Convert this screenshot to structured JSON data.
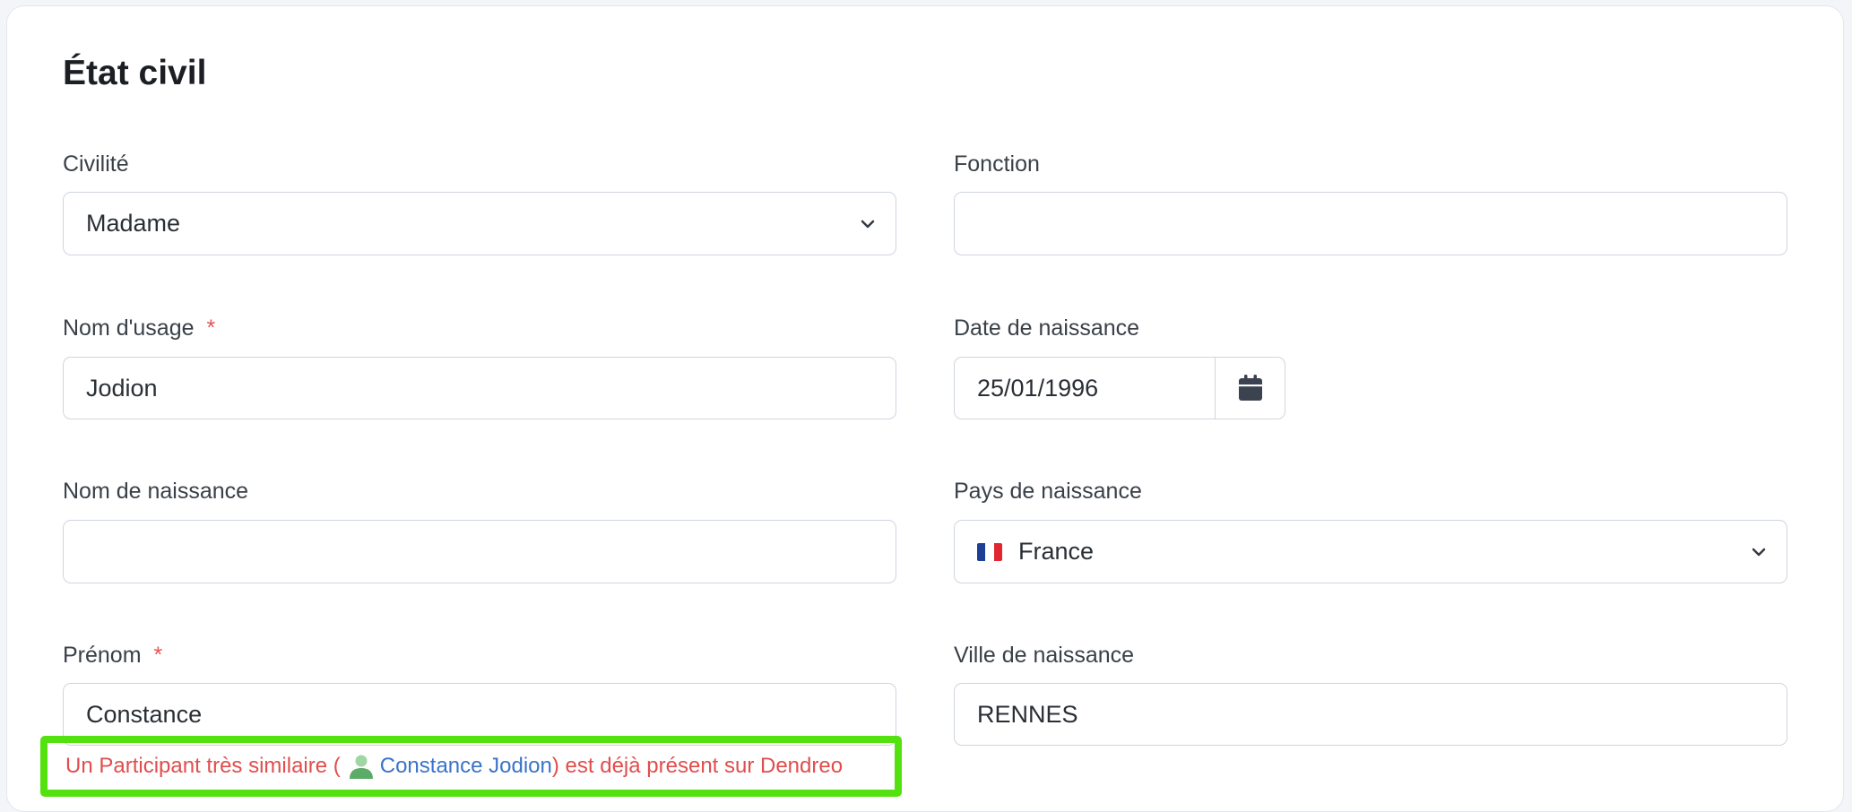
{
  "section": {
    "title": "État civil"
  },
  "fields": {
    "civilite": {
      "label": "Civilité",
      "value": "Madame"
    },
    "fonction": {
      "label": "Fonction",
      "value": ""
    },
    "nom_usage": {
      "label": "Nom d'usage",
      "required_mark": "*",
      "value": "Jodion"
    },
    "date_naissance": {
      "label": "Date de naissance",
      "value": "25/01/1996"
    },
    "nom_naissance": {
      "label": "Nom de naissance",
      "value": ""
    },
    "pays_naissance": {
      "label": "Pays de naissance",
      "value": "France"
    },
    "prenom": {
      "label": "Prénom",
      "required_mark": "*",
      "value": "Constance"
    },
    "ville_naissance": {
      "label": "Ville de naissance",
      "value": "RENNES"
    }
  },
  "warning": {
    "text_before": "Un Participant très similaire (",
    "link_text": "Constance Jodion",
    "text_after": " ) est déjà présent sur Dendreo"
  },
  "colors": {
    "required": "#e25555",
    "warning_text": "#e14d4d",
    "link": "#3a73c9",
    "highlight_border": "#53e20f"
  }
}
